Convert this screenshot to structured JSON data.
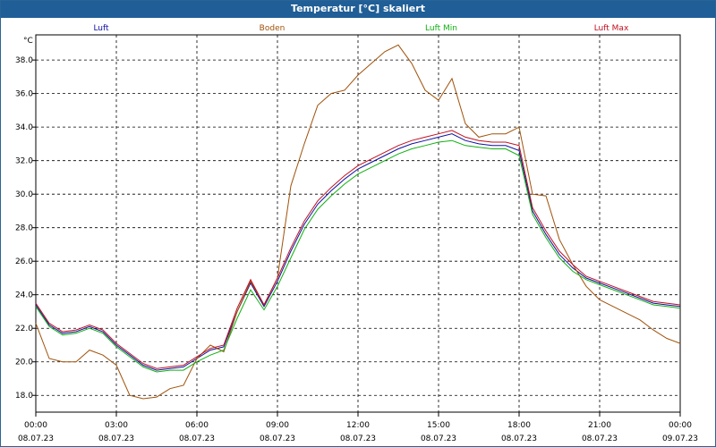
{
  "window": {
    "title": "Temperatur [°C] skaliert"
  },
  "colors": {
    "titlebar": "#1f5e96",
    "luft": "#1010a0",
    "boden": "#a0520a",
    "luft_min": "#10b010",
    "luft_max": "#c01020"
  },
  "chart_data": {
    "type": "line",
    "title": "Temperatur [°C] skaliert",
    "ylabel": "°C",
    "xlabel": "",
    "ylim": [
      17,
      39.5
    ],
    "xlim": [
      0,
      24
    ],
    "grid": true,
    "legend_placement": "top",
    "y_ticks": [
      "18.0",
      "20.0",
      "22.0",
      "24.0",
      "26.0",
      "28.0",
      "30.0",
      "32.0",
      "34.0",
      "36.0",
      "38.0"
    ],
    "x_ticks": [
      {
        "time": "00:00",
        "date": "08.07.23"
      },
      {
        "time": "03:00",
        "date": "08.07.23"
      },
      {
        "time": "06:00",
        "date": "08.07.23"
      },
      {
        "time": "09:00",
        "date": "08.07.23"
      },
      {
        "time": "12:00",
        "date": "08.07.23"
      },
      {
        "time": "15:00",
        "date": "08.07.23"
      },
      {
        "time": "18:00",
        "date": "08.07.23"
      },
      {
        "time": "21:00",
        "date": "08.07.23"
      },
      {
        "time": "00:00",
        "date": "09.07.23"
      }
    ],
    "x": [
      0,
      0.5,
      1,
      1.5,
      2,
      2.5,
      3,
      3.5,
      4,
      4.5,
      5,
      5.5,
      6,
      6.5,
      7,
      7.5,
      8,
      8.5,
      9,
      9.5,
      10,
      10.5,
      11,
      11.5,
      12,
      12.5,
      13,
      13.5,
      14,
      14.5,
      15,
      15.5,
      16,
      16.5,
      17,
      17.5,
      18,
      18.5,
      19,
      19.5,
      20,
      20.5,
      21,
      21.5,
      22,
      22.5,
      23,
      23.5,
      24
    ],
    "series": [
      {
        "name": "Luft",
        "color": "#1010a0",
        "values": [
          23.4,
          22.2,
          21.7,
          21.8,
          22.1,
          21.8,
          21.0,
          20.4,
          19.8,
          19.5,
          19.6,
          19.7,
          20.2,
          20.7,
          20.9,
          23.0,
          24.7,
          23.3,
          24.8,
          26.6,
          28.2,
          29.4,
          30.2,
          30.9,
          31.5,
          31.9,
          32.3,
          32.7,
          33.0,
          33.2,
          33.4,
          33.6,
          33.2,
          33.0,
          32.9,
          32.9,
          32.6,
          29.0,
          27.6,
          26.4,
          25.6,
          25.0,
          24.7,
          24.4,
          24.1,
          23.8,
          23.5,
          23.4,
          23.3
        ]
      },
      {
        "name": "Boden",
        "color": "#a0520a",
        "values": [
          22.3,
          20.2,
          20.0,
          20.0,
          20.7,
          20.4,
          19.8,
          18.0,
          17.8,
          17.9,
          18.4,
          18.6,
          20.2,
          21.0,
          20.6,
          23.0,
          24.8,
          23.4,
          25.0,
          30.5,
          33.0,
          35.3,
          36.0,
          36.2,
          37.1,
          37.8,
          38.5,
          38.9,
          37.8,
          36.2,
          35.6,
          36.9,
          34.2,
          33.4,
          33.6,
          33.6,
          34.0,
          30.0,
          29.9,
          27.3,
          25.8,
          24.5,
          23.7,
          23.3,
          22.9,
          22.5,
          21.9,
          21.4,
          21.1
        ]
      },
      {
        "name": "Luft Min",
        "color": "#10b010",
        "values": [
          23.3,
          22.1,
          21.6,
          21.7,
          22.0,
          21.7,
          20.9,
          20.3,
          19.7,
          19.4,
          19.5,
          19.5,
          20.0,
          20.4,
          20.7,
          22.6,
          24.3,
          23.1,
          24.5,
          26.2,
          27.9,
          29.1,
          29.9,
          30.6,
          31.2,
          31.6,
          32.0,
          32.4,
          32.7,
          32.9,
          33.1,
          33.2,
          32.9,
          32.8,
          32.7,
          32.7,
          32.3,
          28.8,
          27.4,
          26.2,
          25.4,
          24.9,
          24.6,
          24.3,
          24.0,
          23.7,
          23.4,
          23.3,
          23.2
        ]
      },
      {
        "name": "Luft Max",
        "color": "#c01020",
        "values": [
          23.5,
          22.3,
          21.8,
          21.9,
          22.2,
          21.9,
          21.1,
          20.5,
          19.9,
          19.6,
          19.7,
          19.8,
          20.3,
          20.8,
          21.0,
          23.2,
          24.9,
          23.4,
          25.0,
          26.8,
          28.4,
          29.6,
          30.4,
          31.1,
          31.7,
          32.1,
          32.5,
          32.9,
          33.2,
          33.4,
          33.6,
          33.8,
          33.4,
          33.2,
          33.1,
          33.1,
          32.9,
          29.2,
          27.8,
          26.6,
          25.8,
          25.1,
          24.8,
          24.5,
          24.2,
          23.9,
          23.6,
          23.5,
          23.4
        ]
      }
    ]
  }
}
